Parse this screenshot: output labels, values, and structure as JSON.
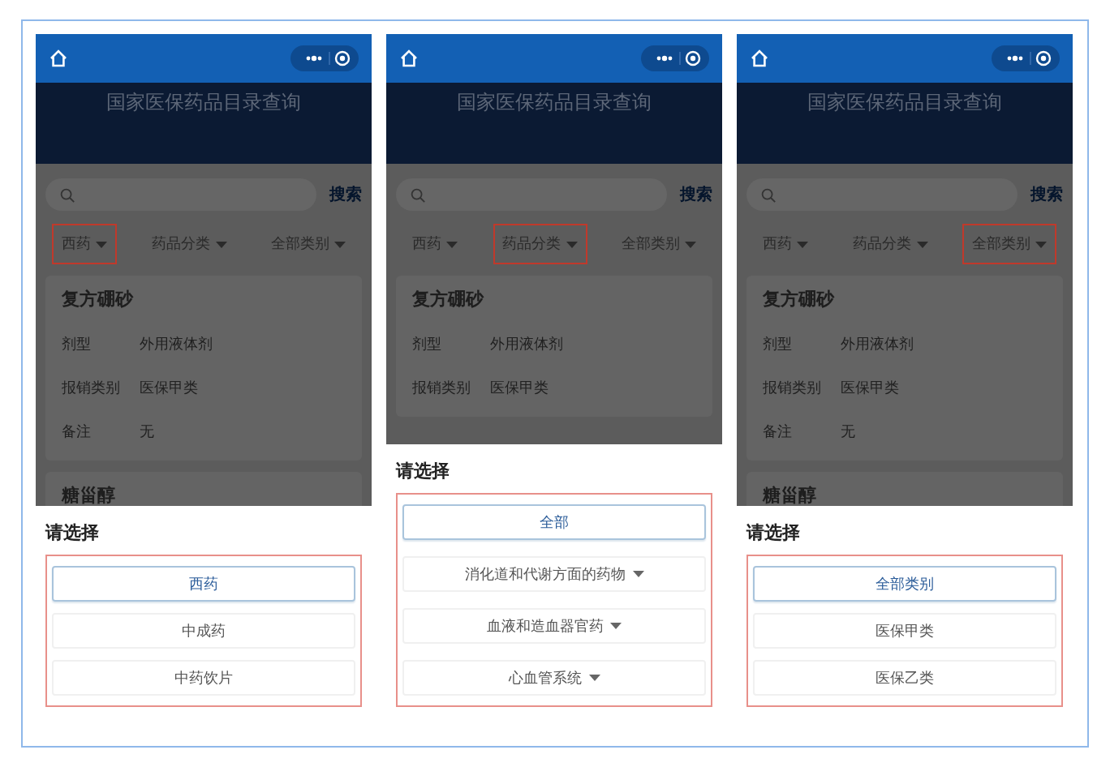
{
  "screens": [
    {
      "title": "国家医保药品目录查询",
      "search_button": "搜索",
      "filters": [
        {
          "label": "西药",
          "highlighted": true
        },
        {
          "label": "药品分类",
          "highlighted": false
        },
        {
          "label": "全部类别",
          "highlighted": false
        }
      ],
      "cards": [
        {
          "title": "复方硼砂",
          "fields": [
            {
              "label": "剂型",
              "value": "外用液体剂"
            },
            {
              "label": "报销类别",
              "value": "医保甲类"
            },
            {
              "label": "备注",
              "value": "无"
            }
          ]
        },
        {
          "title": "糖甾醇"
        }
      ],
      "sheet": {
        "title": "请选择",
        "options": [
          {
            "label": "西药",
            "selected": true,
            "expandable": false
          },
          {
            "label": "中成药",
            "selected": false,
            "expandable": false
          },
          {
            "label": "中药饮片",
            "selected": false,
            "expandable": false
          }
        ]
      }
    },
    {
      "title": "国家医保药品目录查询",
      "search_button": "搜索",
      "filters": [
        {
          "label": "西药",
          "highlighted": false
        },
        {
          "label": "药品分类",
          "highlighted": true
        },
        {
          "label": "全部类别",
          "highlighted": false
        }
      ],
      "cards": [
        {
          "title": "复方硼砂",
          "fields": [
            {
              "label": "剂型",
              "value": "外用液体剂"
            },
            {
              "label": "报销类别",
              "value": "医保甲类"
            }
          ]
        }
      ],
      "sheet": {
        "title": "请选择",
        "options": [
          {
            "label": "全部",
            "selected": true,
            "expandable": false
          },
          {
            "label": "消化道和代谢方面的药物",
            "selected": false,
            "expandable": true
          },
          {
            "label": "血液和造血器官药",
            "selected": false,
            "expandable": true
          },
          {
            "label": "心血管系统",
            "selected": false,
            "expandable": true
          }
        ]
      }
    },
    {
      "title": "国家医保药品目录查询",
      "search_button": "搜索",
      "filters": [
        {
          "label": "西药",
          "highlighted": false
        },
        {
          "label": "药品分类",
          "highlighted": false
        },
        {
          "label": "全部类别",
          "highlighted": true
        }
      ],
      "cards": [
        {
          "title": "复方硼砂",
          "fields": [
            {
              "label": "剂型",
              "value": "外用液体剂"
            },
            {
              "label": "报销类别",
              "value": "医保甲类"
            },
            {
              "label": "备注",
              "value": "无"
            }
          ]
        },
        {
          "title": "糖甾醇"
        }
      ],
      "sheet": {
        "title": "请选择",
        "options": [
          {
            "label": "全部类别",
            "selected": true,
            "expandable": false
          },
          {
            "label": "医保甲类",
            "selected": false,
            "expandable": false
          },
          {
            "label": "医保乙类",
            "selected": false,
            "expandable": false
          }
        ]
      }
    }
  ]
}
